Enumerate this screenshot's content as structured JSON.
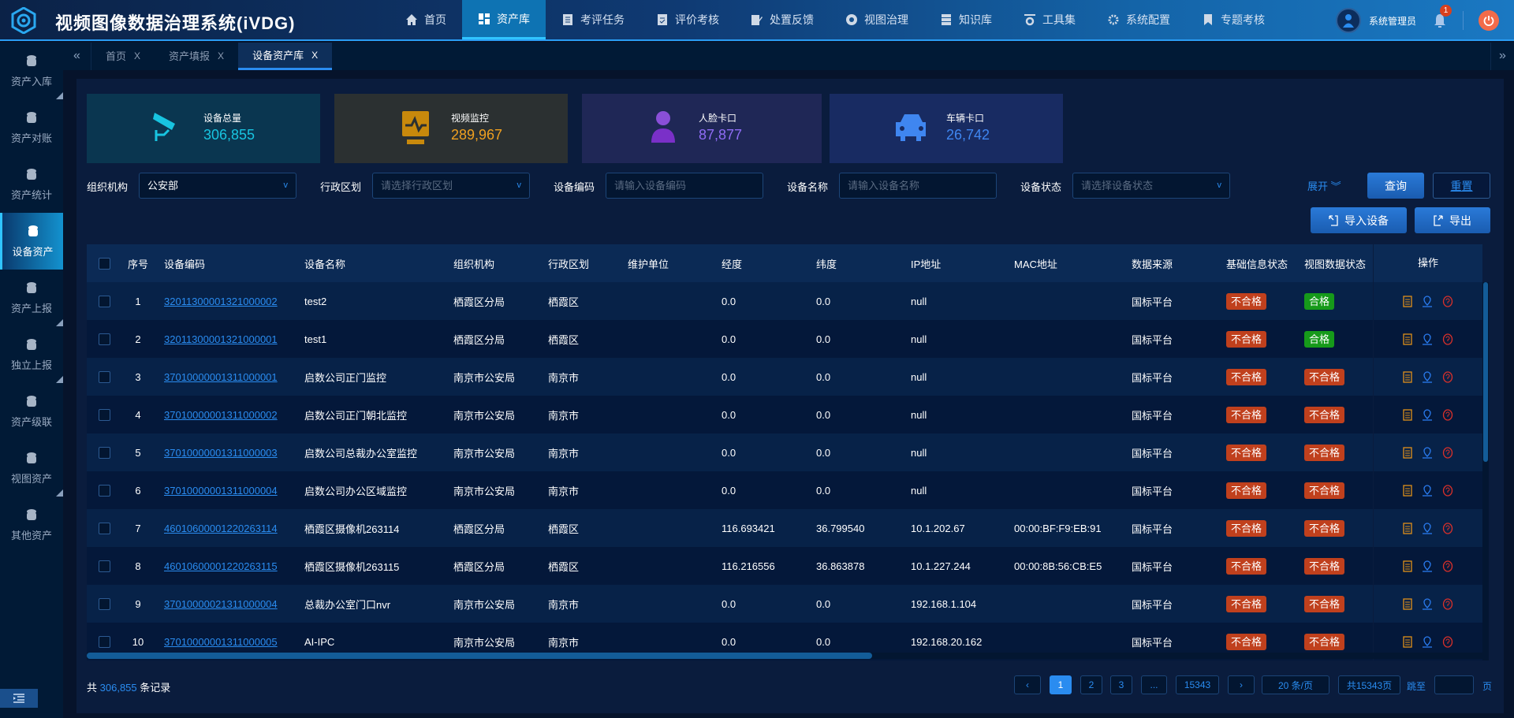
{
  "header": {
    "title": "视频图像数据治理系统(iVDG)",
    "nav": [
      {
        "label": "首页",
        "icon": "home-icon"
      },
      {
        "label": "资产库",
        "icon": "grid-icon",
        "active": true
      },
      {
        "label": "考评任务",
        "icon": "doc-icon"
      },
      {
        "label": "评价考核",
        "icon": "doc-check-icon"
      },
      {
        "label": "处置反馈",
        "icon": "edit-icon"
      },
      {
        "label": "视图治理",
        "icon": "aperture-icon"
      },
      {
        "label": "知识库",
        "icon": "server-icon"
      },
      {
        "label": "工具集",
        "icon": "tools-icon"
      },
      {
        "label": "系统配置",
        "icon": "gear-icon"
      },
      {
        "label": "专题考核",
        "icon": "bookmark-icon"
      }
    ],
    "user": "系统管理员",
    "notifications": "1"
  },
  "tabs": [
    {
      "label": "首页",
      "close": "X"
    },
    {
      "label": "资产填报",
      "close": "X"
    },
    {
      "label": "设备资产库",
      "close": "X",
      "active": true
    }
  ],
  "sidebar": [
    {
      "label": "资产入库"
    },
    {
      "label": "资产对账"
    },
    {
      "label": "资产统计"
    },
    {
      "label": "设备资产",
      "active": true
    },
    {
      "label": "资产上报"
    },
    {
      "label": "独立上报"
    },
    {
      "label": "资产级联"
    },
    {
      "label": "视图资产"
    },
    {
      "label": "其他资产"
    }
  ],
  "stats": [
    {
      "label": "设备总量",
      "value": "306,855",
      "color": "#18c4e0",
      "bg": "#0a3650"
    },
    {
      "label": "视频监控",
      "value": "289,967",
      "color": "#f0a020",
      "bg": "#2b3031"
    },
    {
      "label": "人脸卡口",
      "value": "87,877",
      "color": "#8f6cf5",
      "bg": "#1f2756"
    },
    {
      "label": "车辆卡口",
      "value": "26,742",
      "color": "#3f86f0",
      "bg": "#182b62"
    }
  ],
  "filters": {
    "org": {
      "label": "组织机构",
      "value": "公安部"
    },
    "region": {
      "label": "行政区划",
      "placeholder": "请选择行政区划"
    },
    "code": {
      "label": "设备编码",
      "placeholder": "请输入设备编码"
    },
    "name": {
      "label": "设备名称",
      "placeholder": "请输入设备名称"
    },
    "status": {
      "label": "设备状态",
      "placeholder": "请选择设备状态"
    },
    "expand": "展开",
    "query": "查询",
    "reset": "重置",
    "import": "导入设备",
    "export": "导出"
  },
  "table": {
    "columns": [
      "序号",
      "设备编码",
      "设备名称",
      "组织机构",
      "行政区划",
      "维护单位",
      "经度",
      "纬度",
      "IP地址",
      "MAC地址",
      "数据来源",
      "基础信息状态",
      "视图数据状态",
      "操作"
    ],
    "rows": [
      [
        "1",
        "32011300001321000002",
        "test2",
        "栖霞区分局",
        "栖霞区",
        "",
        "0.0",
        "0.0",
        "null",
        "",
        "国标平台",
        "不合格",
        "合格"
      ],
      [
        "2",
        "32011300001321000001",
        "test1",
        "栖霞区分局",
        "栖霞区",
        "",
        "0.0",
        "0.0",
        "null",
        "",
        "国标平台",
        "不合格",
        "合格"
      ],
      [
        "3",
        "37010000001311000001",
        "启数公司正门监控",
        "南京市公安局",
        "南京市",
        "",
        "0.0",
        "0.0",
        "null",
        "",
        "国标平台",
        "不合格",
        "不合格"
      ],
      [
        "4",
        "37010000001311000002",
        "启数公司正门朝北监控",
        "南京市公安局",
        "南京市",
        "",
        "0.0",
        "0.0",
        "null",
        "",
        "国标平台",
        "不合格",
        "不合格"
      ],
      [
        "5",
        "37010000001311000003",
        "启数公司总裁办公室监控",
        "南京市公安局",
        "南京市",
        "",
        "0.0",
        "0.0",
        "null",
        "",
        "国标平台",
        "不合格",
        "不合格"
      ],
      [
        "6",
        "37010000001311000004",
        "启数公司办公区域监控",
        "南京市公安局",
        "南京市",
        "",
        "0.0",
        "0.0",
        "null",
        "",
        "国标平台",
        "不合格",
        "不合格"
      ],
      [
        "7",
        "46010600001220263114",
        "栖霞区摄像机263114",
        "栖霞区分局",
        "栖霞区",
        "",
        "116.693421",
        "36.799540",
        "10.1.202.67",
        "00:00:BF:F9:EB:91",
        "国标平台",
        "不合格",
        "不合格"
      ],
      [
        "8",
        "46010600001220263115",
        "栖霞区摄像机263115",
        "栖霞区分局",
        "栖霞区",
        "",
        "116.216556",
        "36.863878",
        "10.1.227.244",
        "00:00:8B:56:CB:E5",
        "国标平台",
        "不合格",
        "不合格"
      ],
      [
        "9",
        "37010000021311000004",
        "总裁办公室门口nvr",
        "南京市公安局",
        "南京市",
        "",
        "0.0",
        "0.0",
        "192.168.1.104",
        "",
        "国标平台",
        "不合格",
        "不合格"
      ],
      [
        "10",
        "37010000001311000005",
        "AI-IPC",
        "南京市公安局",
        "南京市",
        "",
        "0.0",
        "0.0",
        "192.168.20.162",
        "",
        "国标平台",
        "不合格",
        "不合格"
      ]
    ]
  },
  "footer": {
    "prefix": "共",
    "total": "306,855",
    "suffix": "条记录",
    "pages": [
      "1",
      "2",
      "3",
      "...",
      "15343"
    ],
    "prev": "‹",
    "next": "›",
    "page_size": "20 条/页",
    "total_pages": "共15343页",
    "jump": "跳至",
    "jump_value": "",
    "page_unit": "页"
  }
}
